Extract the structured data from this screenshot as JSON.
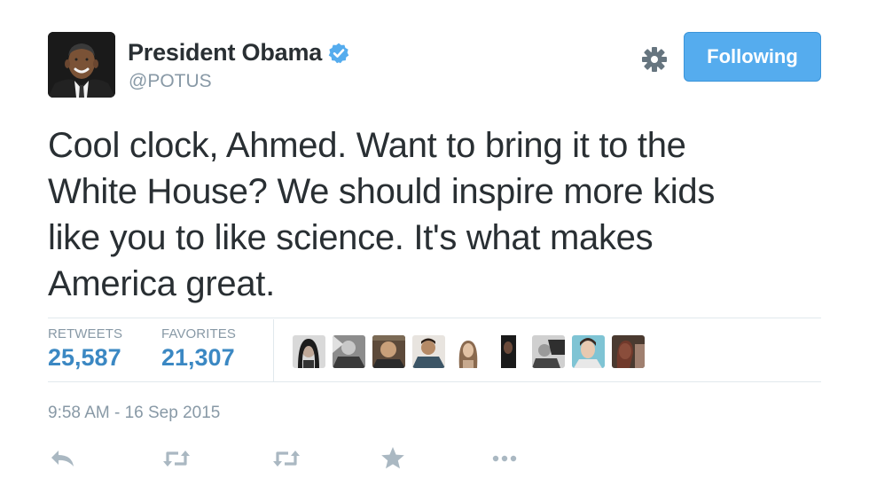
{
  "header": {
    "display_name": "President Obama",
    "handle": "@POTUS",
    "follow_label": "Following"
  },
  "tweet": {
    "text": "Cool clock, Ahmed. Want to bring it to the\nWhite House? We should inspire more kids\nlike you to like science. It's what makes\nAmerica great.",
    "timestamp": "9:58 AM - 16 Sep 2015"
  },
  "stats": {
    "retweets_label": "RETWEETS",
    "retweets_value": "25,587",
    "favorites_label": "FAVORITES",
    "favorites_value": "21,307"
  },
  "colors": {
    "follow_button": "#55acee",
    "stat_value": "#3b88c3",
    "muted_text": "#8899a6",
    "icon_grey": "#aab8c2"
  },
  "icons": [
    "verified-badge-icon",
    "gear-icon",
    "reply-icon",
    "retweet-icon",
    "favorite-star-icon",
    "more-dots-icon"
  ]
}
